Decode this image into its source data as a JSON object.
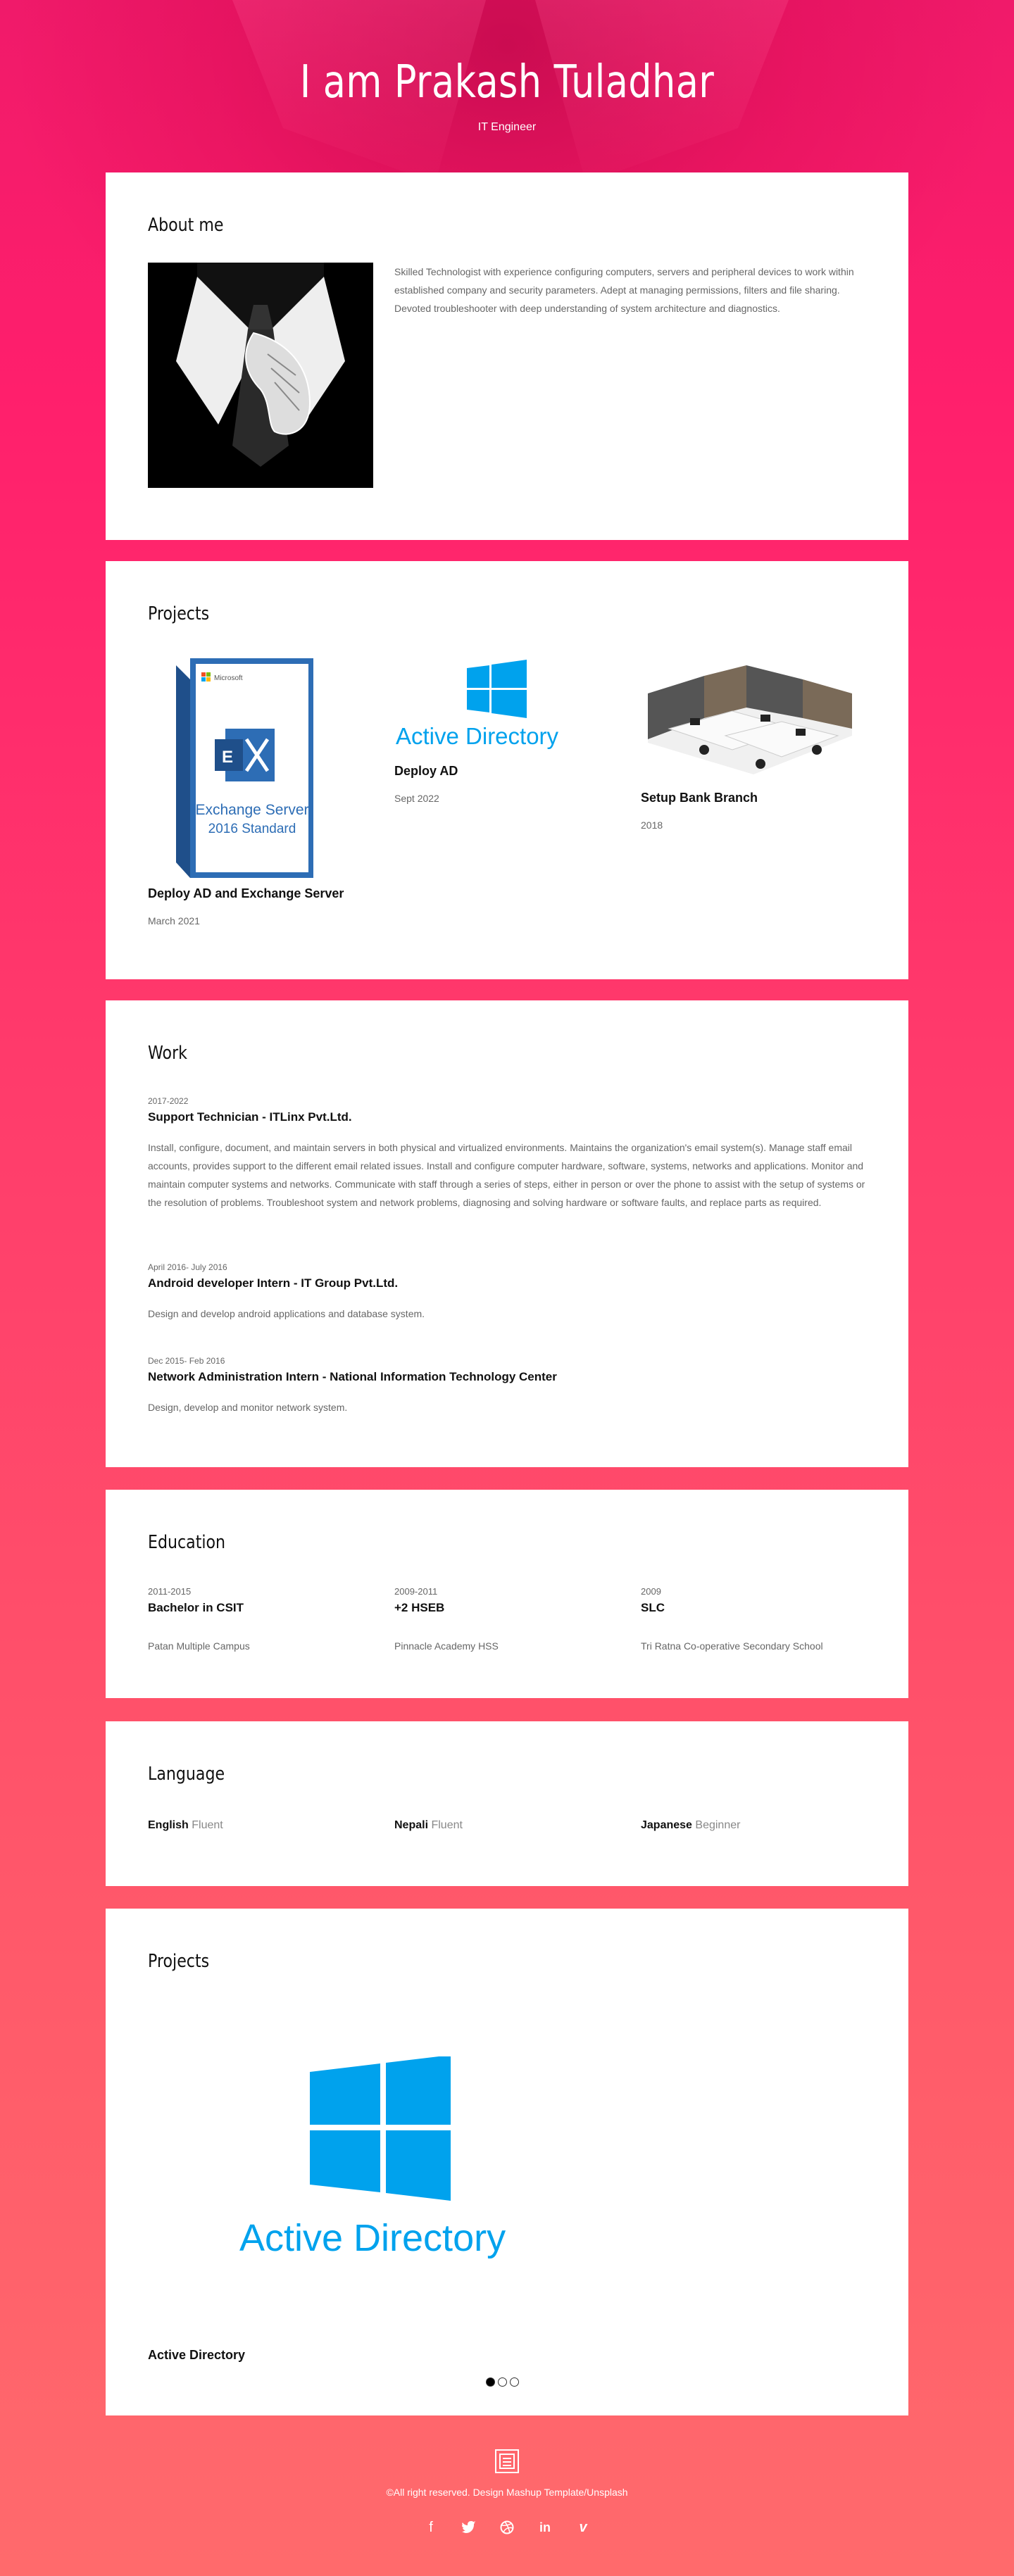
{
  "header": {
    "title": "I am Prakash Tuladhar",
    "subtitle": "IT Engineer"
  },
  "about": {
    "heading": "About me",
    "text": "Skilled Technologist with experience configuring computers, servers and peripheral devices to work within established company and security parameters. Adept at managing permissions, filters and file sharing. Devoted troubleshooter with deep understanding of system architecture and diagnostics."
  },
  "projects": {
    "heading": "Projects",
    "items": [
      {
        "title": "Deploy AD and Exchange Server",
        "date": "March 2021",
        "image_label_1": "Exchange Server",
        "image_label_2": "2016 Standard",
        "image_brand": "Microsoft"
      },
      {
        "title": "Deploy AD",
        "date": "Sept 2022",
        "image_label": "Active Directory"
      },
      {
        "title": "Setup Bank Branch",
        "date": "2018"
      }
    ]
  },
  "work": {
    "heading": "Work",
    "items": [
      {
        "date": "2017-2022",
        "title": "Support Technician - ITLinx Pvt.Ltd.",
        "desc": "Install, configure, document, and maintain servers in both physical and virtualized environments. Maintains the organization's email system(s). Manage staff email accounts, provides support to the different email related issues. Install and configure computer hardware, software, systems, networks and applications. Monitor and maintain computer systems and networks. Communicate with staff through a series of steps, either in person or over the phone to assist with the setup of systems or the resolution of problems. Troubleshoot system and network problems, diagnosing and solving hardware or software faults, and replace parts as required."
      },
      {
        "date": "April 2016- July 2016",
        "title": "Android developer Intern - IT Group Pvt.Ltd.",
        "desc": "Design and develop android applications and database system."
      },
      {
        "date": "Dec 2015- Feb 2016",
        "title": "Network Administration Intern - National Information Technology Center",
        "desc": "Design, develop and monitor network system."
      }
    ]
  },
  "education": {
    "heading": "Education",
    "items": [
      {
        "date": "2011-2015",
        "title": "Bachelor in CSIT",
        "place": "Patan Multiple Campus"
      },
      {
        "date": "2009-2011",
        "title": "+2 HSEB",
        "place": "Pinnacle Academy HSS"
      },
      {
        "date": "2009",
        "title": "SLC",
        "place": "Tri Ratna Co-operative Secondary School"
      }
    ]
  },
  "language": {
    "heading": "Language",
    "items": [
      {
        "name": "English",
        "level": "Fluent"
      },
      {
        "name": "Nepali",
        "level": "Fluent"
      },
      {
        "name": "Japanese",
        "level": "Beginner"
      }
    ]
  },
  "projects2": {
    "heading": "Projects",
    "slide_title": "Active Directory",
    "image_label": "Active Directory",
    "active_slide": 1,
    "slide_count": 3
  },
  "footer": {
    "copyright": "©All right reserved. Design Mashup Template/Unsplash"
  },
  "colors": {
    "accent": "#ff1f6c",
    "win_blue": "#00a2ed",
    "exchange_blue": "#2b6cb0"
  }
}
